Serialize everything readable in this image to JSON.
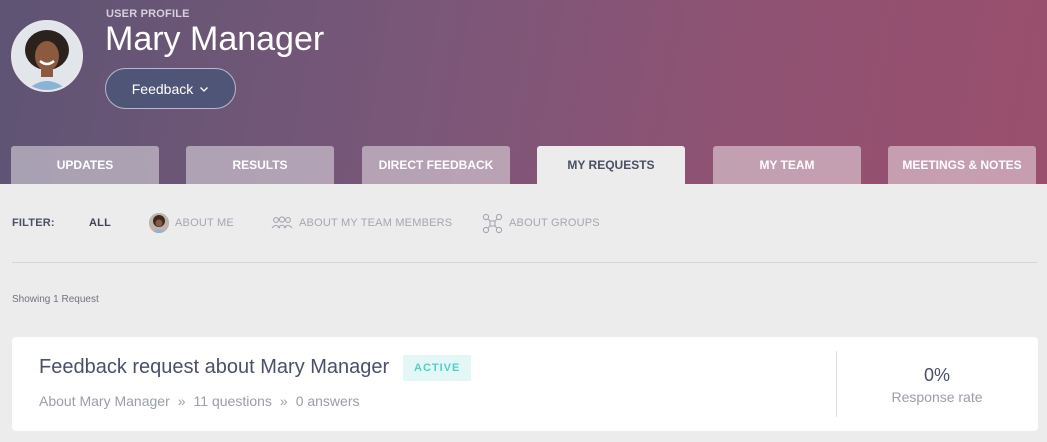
{
  "header": {
    "section_label": "USER PROFILE",
    "name": "Mary Manager",
    "feedback_button": "Feedback",
    "accent_gradient": [
      "#5e5474",
      "#9a4f6d"
    ]
  },
  "tabs": [
    {
      "label": "UPDATES",
      "active": false
    },
    {
      "label": "RESULTS",
      "active": false
    },
    {
      "label": "DIRECT FEEDBACK",
      "active": false
    },
    {
      "label": "MY REQUESTS",
      "active": true
    },
    {
      "label": "MY TEAM",
      "active": false
    },
    {
      "label": "MEETINGS & NOTES",
      "active": false
    }
  ],
  "filter": {
    "label": "FILTER:",
    "options": [
      {
        "label": "ALL",
        "icon": null,
        "active": true
      },
      {
        "label": "ABOUT ME",
        "icon": "avatar",
        "active": false
      },
      {
        "label": "ABOUT MY TEAM MEMBERS",
        "icon": "team-icon",
        "active": false
      },
      {
        "label": "ABOUT GROUPS",
        "icon": "groups-icon",
        "active": false
      }
    ]
  },
  "showing_text": "Showing 1 Request",
  "requests": [
    {
      "title": "Feedback request about Mary Manager",
      "status": "ACTIVE",
      "about": "About Mary Manager",
      "sep": "»",
      "questions": "11 questions",
      "answers": "0 answers",
      "response_rate": "0%",
      "response_label": "Response rate"
    }
  ],
  "colors": {
    "badge_text": "#4fd1c9",
    "badge_bg": "#e3f8f6",
    "active_tab_text": "#4a4f66"
  }
}
